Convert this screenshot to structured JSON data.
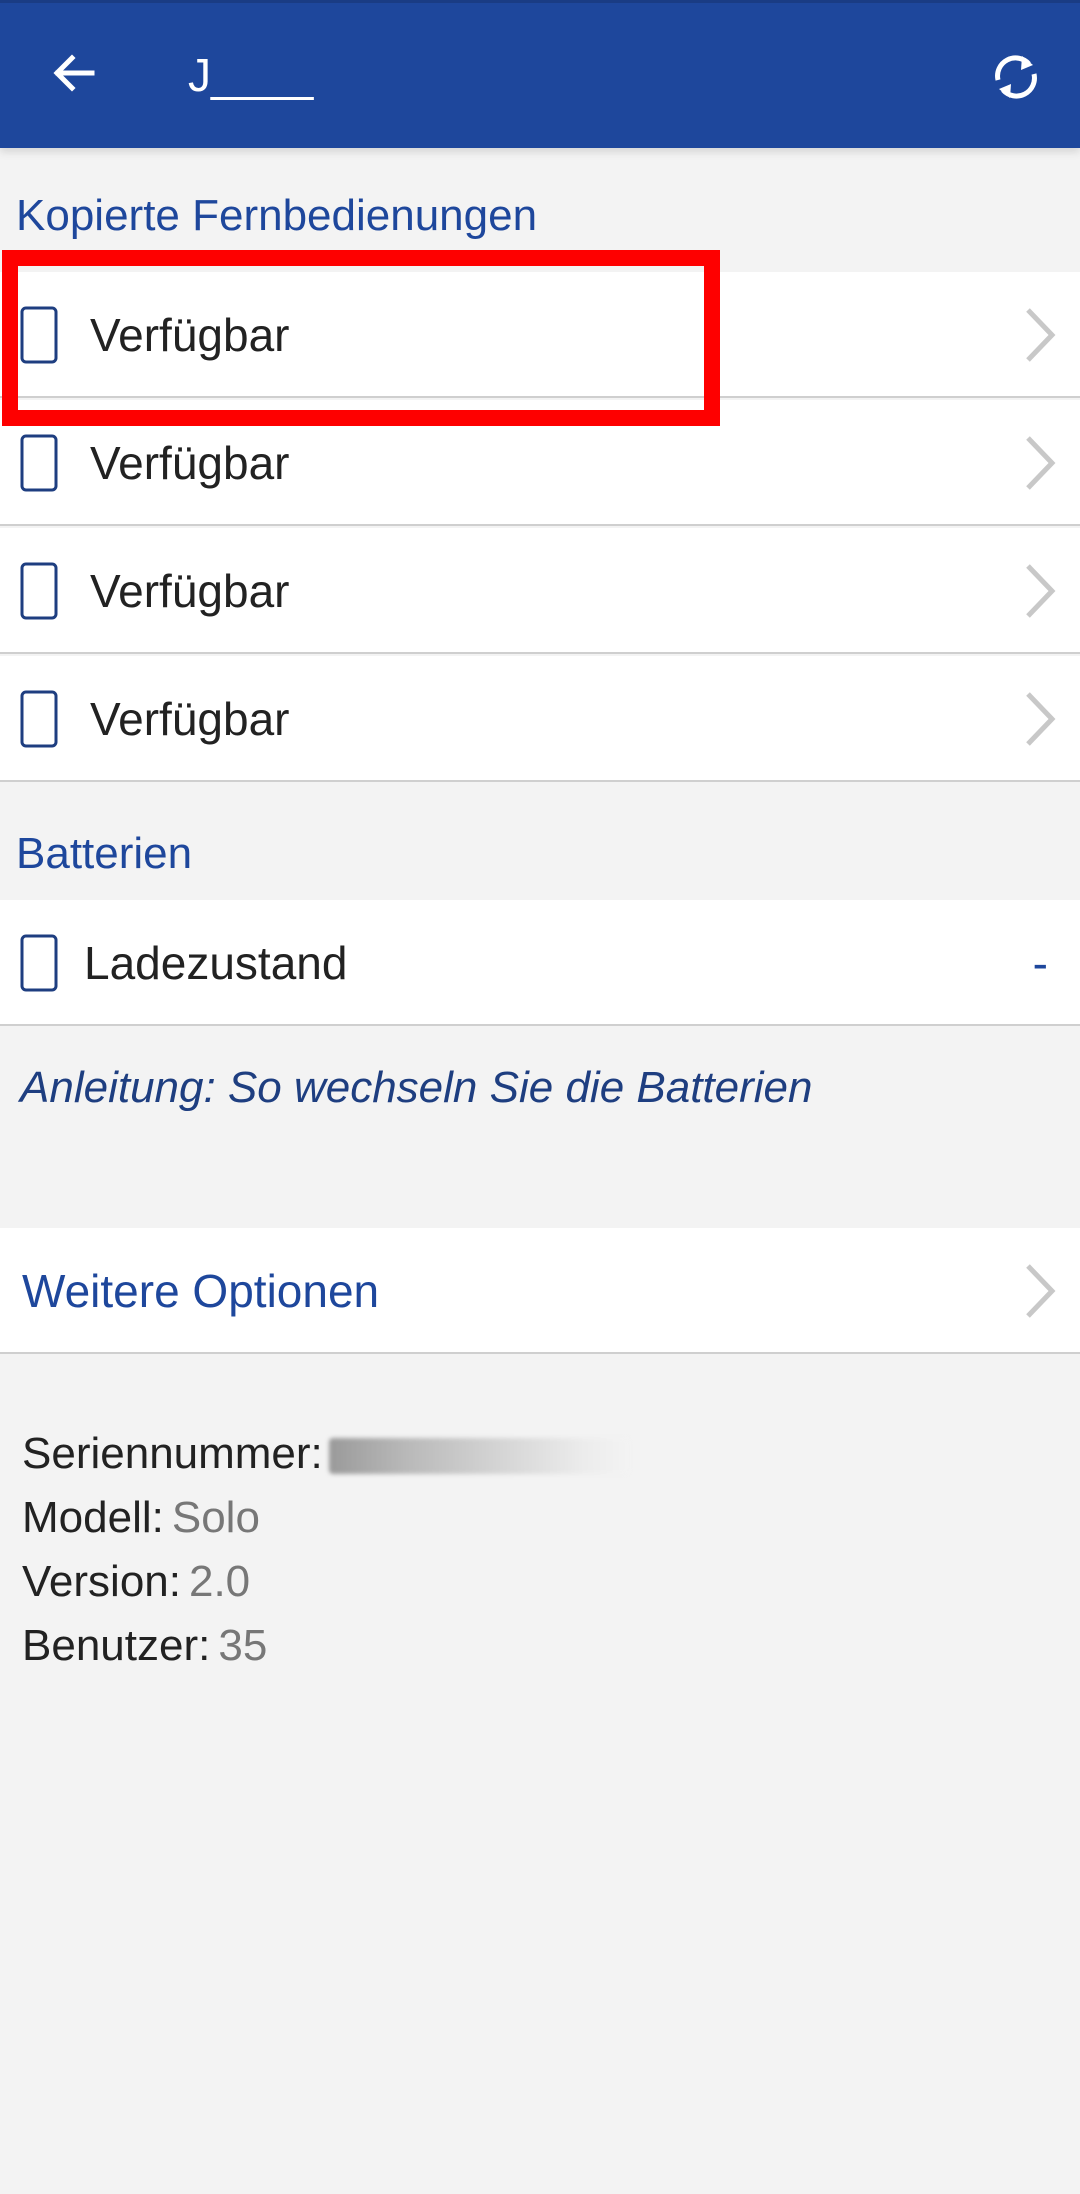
{
  "appbar": {
    "title": "J____",
    "back_icon": "arrow-left-icon",
    "sync_icon": "sync-icon",
    "color": "#1e479c"
  },
  "remotes": {
    "header": "Kopierte Fernbedienungen",
    "items": [
      {
        "label": "Verfügbar",
        "icon": "remote-device-icon"
      },
      {
        "label": "Verfügbar",
        "icon": "remote-device-icon"
      },
      {
        "label": "Verfügbar",
        "icon": "remote-device-icon"
      },
      {
        "label": "Verfügbar",
        "icon": "remote-device-icon"
      }
    ]
  },
  "batteries": {
    "header": "Batterien",
    "charge_label": "Ladezustand",
    "charge_value": "-",
    "guide_link": "Anleitung: So wechseln Sie die Batterien"
  },
  "options": {
    "label": "Weitere Optionen"
  },
  "device_info": {
    "serial_label": "Seriennummer:",
    "model_label": "Modell:",
    "model_value": "Solo",
    "version_label": "Version:",
    "version_value": "2.0",
    "users_label": "Benutzer:",
    "users_value": "35"
  },
  "colors": {
    "accent": "#1e479c",
    "highlight": "#fe0000",
    "background": "#f3f3f3"
  }
}
